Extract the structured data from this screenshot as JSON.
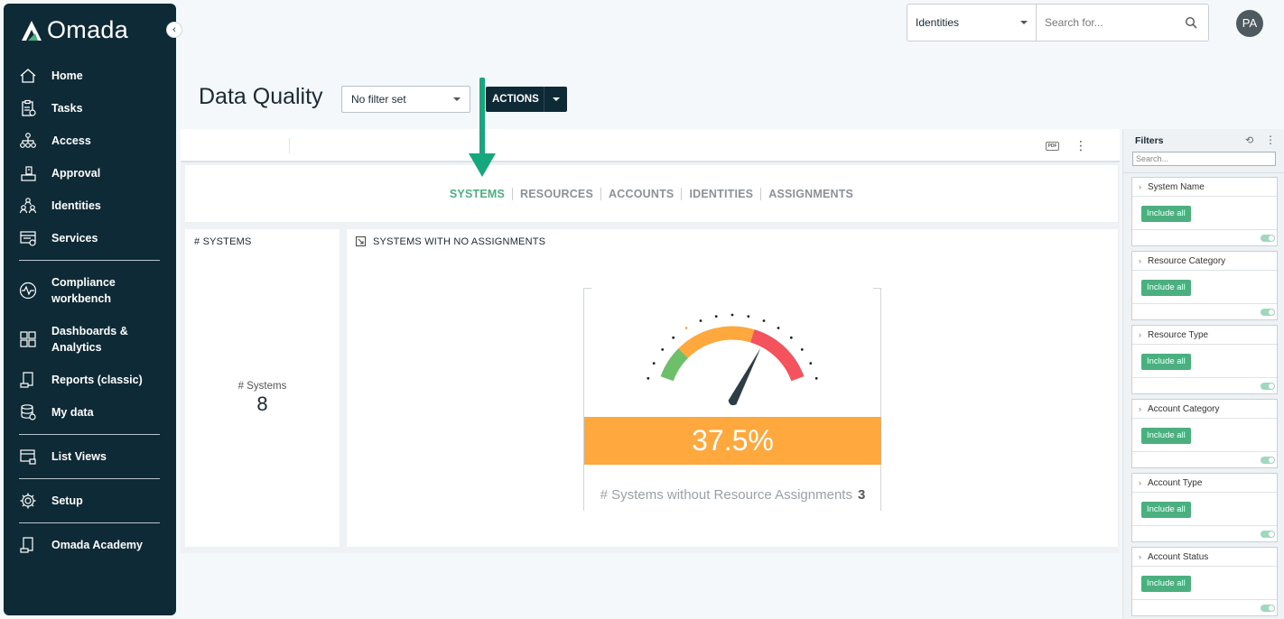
{
  "app": {
    "logo_text": "Omada"
  },
  "sidebar": {
    "items": [
      {
        "label": "Home",
        "icon": "home-icon"
      },
      {
        "label": "Tasks",
        "icon": "clipboard-icon"
      },
      {
        "label": "Access",
        "icon": "hierarchy-icon"
      },
      {
        "label": "Approval",
        "icon": "approval-icon"
      },
      {
        "label": "Identities",
        "icon": "people-icon"
      },
      {
        "label": "Services",
        "icon": "services-icon"
      },
      {
        "label": "Compliance workbench",
        "icon": "pulse-icon"
      },
      {
        "label": "Dashboards & Analytics",
        "icon": "grid-icon"
      },
      {
        "label": "Reports (classic)",
        "icon": "reports-icon"
      },
      {
        "label": "My data",
        "icon": "database-icon"
      },
      {
        "label": "List Views",
        "icon": "list-view-icon"
      },
      {
        "label": "Setup",
        "icon": "gear-icon"
      },
      {
        "label": "Omada Academy",
        "icon": "academy-icon"
      }
    ]
  },
  "header": {
    "search_scope": "Identities",
    "search_placeholder": "Search for...",
    "avatar_initials": "PA"
  },
  "page": {
    "title": "Data Quality",
    "filter_value": "No filter set",
    "actions_label": "ACTIONS"
  },
  "toolbar": {
    "pdf_label": "PDF"
  },
  "tabs": [
    {
      "label": "SYSTEMS",
      "active": true
    },
    {
      "label": "RESOURCES",
      "active": false
    },
    {
      "label": "ACCOUNTS",
      "active": false
    },
    {
      "label": "IDENTITIES",
      "active": false
    },
    {
      "label": "ASSIGNMENTS",
      "active": false
    }
  ],
  "systems_card": {
    "title": "# SYSTEMS",
    "kpi_label": "# Systems",
    "kpi_value": "8"
  },
  "gauge_card": {
    "title": "SYSTEMS WITH NO ASSIGNMENTS",
    "percent_text": "37.5%",
    "percent_value": 37.5,
    "caption": "# Systems without Resource Assignments",
    "caption_value": "3",
    "colors": {
      "green": "#6dbf6a",
      "orange": "#ffa83e",
      "red": "#f4525c",
      "needle": "#2e3d45"
    }
  },
  "filters": {
    "title": "Filters",
    "search_placeholder": "Search...",
    "groups": [
      {
        "label": "System Name",
        "chip": "Include all"
      },
      {
        "label": "Resource Category",
        "chip": "Include all"
      },
      {
        "label": "Resource Type",
        "chip": "Include all"
      },
      {
        "label": "Account Category",
        "chip": "Include all"
      },
      {
        "label": "Account Type",
        "chip": "Include all"
      },
      {
        "label": "Account Status",
        "chip": "Include all"
      }
    ]
  },
  "colors": {
    "sidebar": "#0d2a36",
    "accent_green": "#4caf80",
    "annotation_arrow": "#17a77e"
  }
}
